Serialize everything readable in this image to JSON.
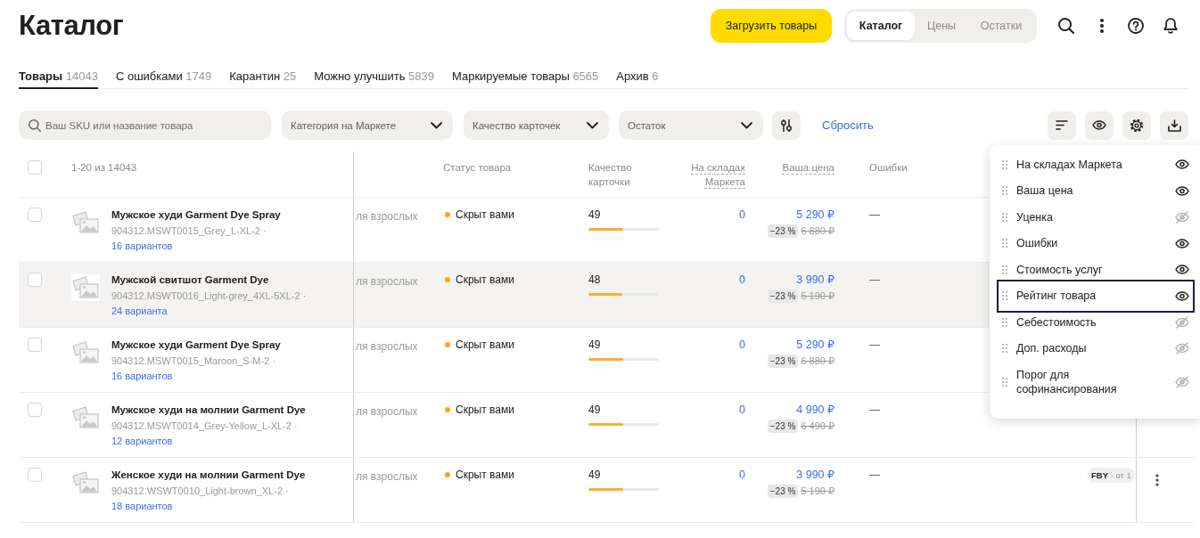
{
  "page": {
    "title": "Каталог"
  },
  "header": {
    "upload_button": "Загрузить товары",
    "sections": [
      {
        "label": "Каталог",
        "selected": true
      },
      {
        "label": "Цены",
        "selected": false
      },
      {
        "label": "Остатки",
        "selected": false
      }
    ]
  },
  "tabs": [
    {
      "label": "Товары",
      "count": "14043",
      "selected": true
    },
    {
      "label": "С ошибками",
      "count": "1749",
      "selected": false
    },
    {
      "label": "Карантин",
      "count": "25",
      "selected": false
    },
    {
      "label": "Можно улучшить",
      "count": "5839",
      "selected": false
    },
    {
      "label": "Маркируемые товары",
      "count": "6565",
      "selected": false
    },
    {
      "label": "Архив",
      "count": "6",
      "selected": false
    }
  ],
  "filters": {
    "search": {
      "placeholder": "Ваш SKU или название товара"
    },
    "dropdowns": [
      {
        "label": "Категория на Маркете"
      },
      {
        "label": "Качество карточек"
      },
      {
        "label": "Остаток"
      }
    ],
    "reset_link": "Сбросить"
  },
  "table": {
    "select_all": {
      "checked": false
    },
    "range": "1-20 из 14043",
    "columns": [
      {
        "label": "Статус товара",
        "kind": "plain"
      },
      {
        "label": "Качество карточки",
        "kind": "plain"
      },
      {
        "label": "На складах Маркета",
        "kind": "sortable"
      },
      {
        "label": "Ваша цена",
        "kind": "sortable"
      },
      {
        "label": "Ошибки",
        "kind": "plain"
      }
    ],
    "rows": [
      {
        "checked": false,
        "highlighted": false,
        "name": "Мужское худи Garment Dye Spray",
        "sku": "904312.MSWT0015_Grey_L-XL-2 ·",
        "variants": "16 вариантов",
        "column_3": "ля взрослых",
        "status": "Скрыт вами",
        "quality": "49",
        "level": 0.49,
        "stock": "0",
        "price": "5 290 ₽",
        "discount": "−23 %",
        "old_price": "6 880 ₽",
        "errors": "—",
        "actions_menu": false
      },
      {
        "checked": false,
        "highlighted": true,
        "name": "Мужской свитшот Garment Dye",
        "sku": "904312.MSWT0016_Light-grey_4XL-5XL-2 ·",
        "variants": "24 варианта",
        "column_3": "ля взрослых",
        "status": "Скрыт вами",
        "quality": "48",
        "level": 0.48,
        "stock": "0",
        "price": "3 990 ₽",
        "discount": "−23 %",
        "old_price": "5 190 ₽",
        "errors": "—",
        "actions_menu": false
      },
      {
        "checked": false,
        "highlighted": false,
        "name": "Мужское худи Garment Dye Spray",
        "sku": "904312.MSWT0015_Maroon_S-M-2 ·",
        "variants": "16 вариантов",
        "column_3": "ля взрослых",
        "status": "Скрыт вами",
        "quality": "49",
        "level": 0.49,
        "stock": "0",
        "price": "5 290 ₽",
        "discount": "−23 %",
        "old_price": "6 880 ₽",
        "errors": "—",
        "actions_menu": false
      },
      {
        "checked": false,
        "highlighted": false,
        "name": "Мужское худи на молнии Garment Dye",
        "sku": "904312.MSWT0014_Grey-Yellow_L-XL-2 ·",
        "variants": "12 вариантов",
        "column_3": "ля взрослых",
        "status": "Скрыт вами",
        "quality": "49",
        "level": 0.49,
        "stock": "0",
        "price": "4 990 ₽",
        "discount": "−23 %",
        "old_price": "6 490 ₽",
        "errors": "—",
        "actions_menu": false
      },
      {
        "checked": false,
        "highlighted": false,
        "name": "Женское худи на молнии Garment Dye",
        "sku": "904312.WSWT0010_Light-brown_XL-2 ·",
        "variants": "18 вариантов",
        "column_3": "ля взрослых",
        "status": "Скрыт вами",
        "quality": "49",
        "level": 0.49,
        "stock": "0",
        "price": "3 990 ₽",
        "discount": "−23 %",
        "old_price": "5 190 ₽",
        "errors": "—",
        "offer": "**FBY** · от 1",
        "actions_menu": true
      }
    ]
  },
  "column_panel": {
    "items": [
      {
        "label": "На складах Маркета",
        "visible": true,
        "focused": false
      },
      {
        "label": "Ваша цена",
        "visible": true,
        "focused": false
      },
      {
        "label": "Уценка",
        "visible": false,
        "focused": false
      },
      {
        "label": "Ошибки",
        "visible": true,
        "focused": false
      },
      {
        "label": "Стоимость услуг",
        "visible": true,
        "focused": false
      },
      {
        "label": "Рейтинг товара",
        "visible": true,
        "focused": true
      },
      {
        "label": "Себестоимость",
        "visible": false,
        "focused": false
      },
      {
        "label": "Доп. расходы",
        "visible": false,
        "focused": false
      },
      {
        "label": "Порог для софинансирования",
        "visible": false,
        "focused": false
      }
    ]
  }
}
